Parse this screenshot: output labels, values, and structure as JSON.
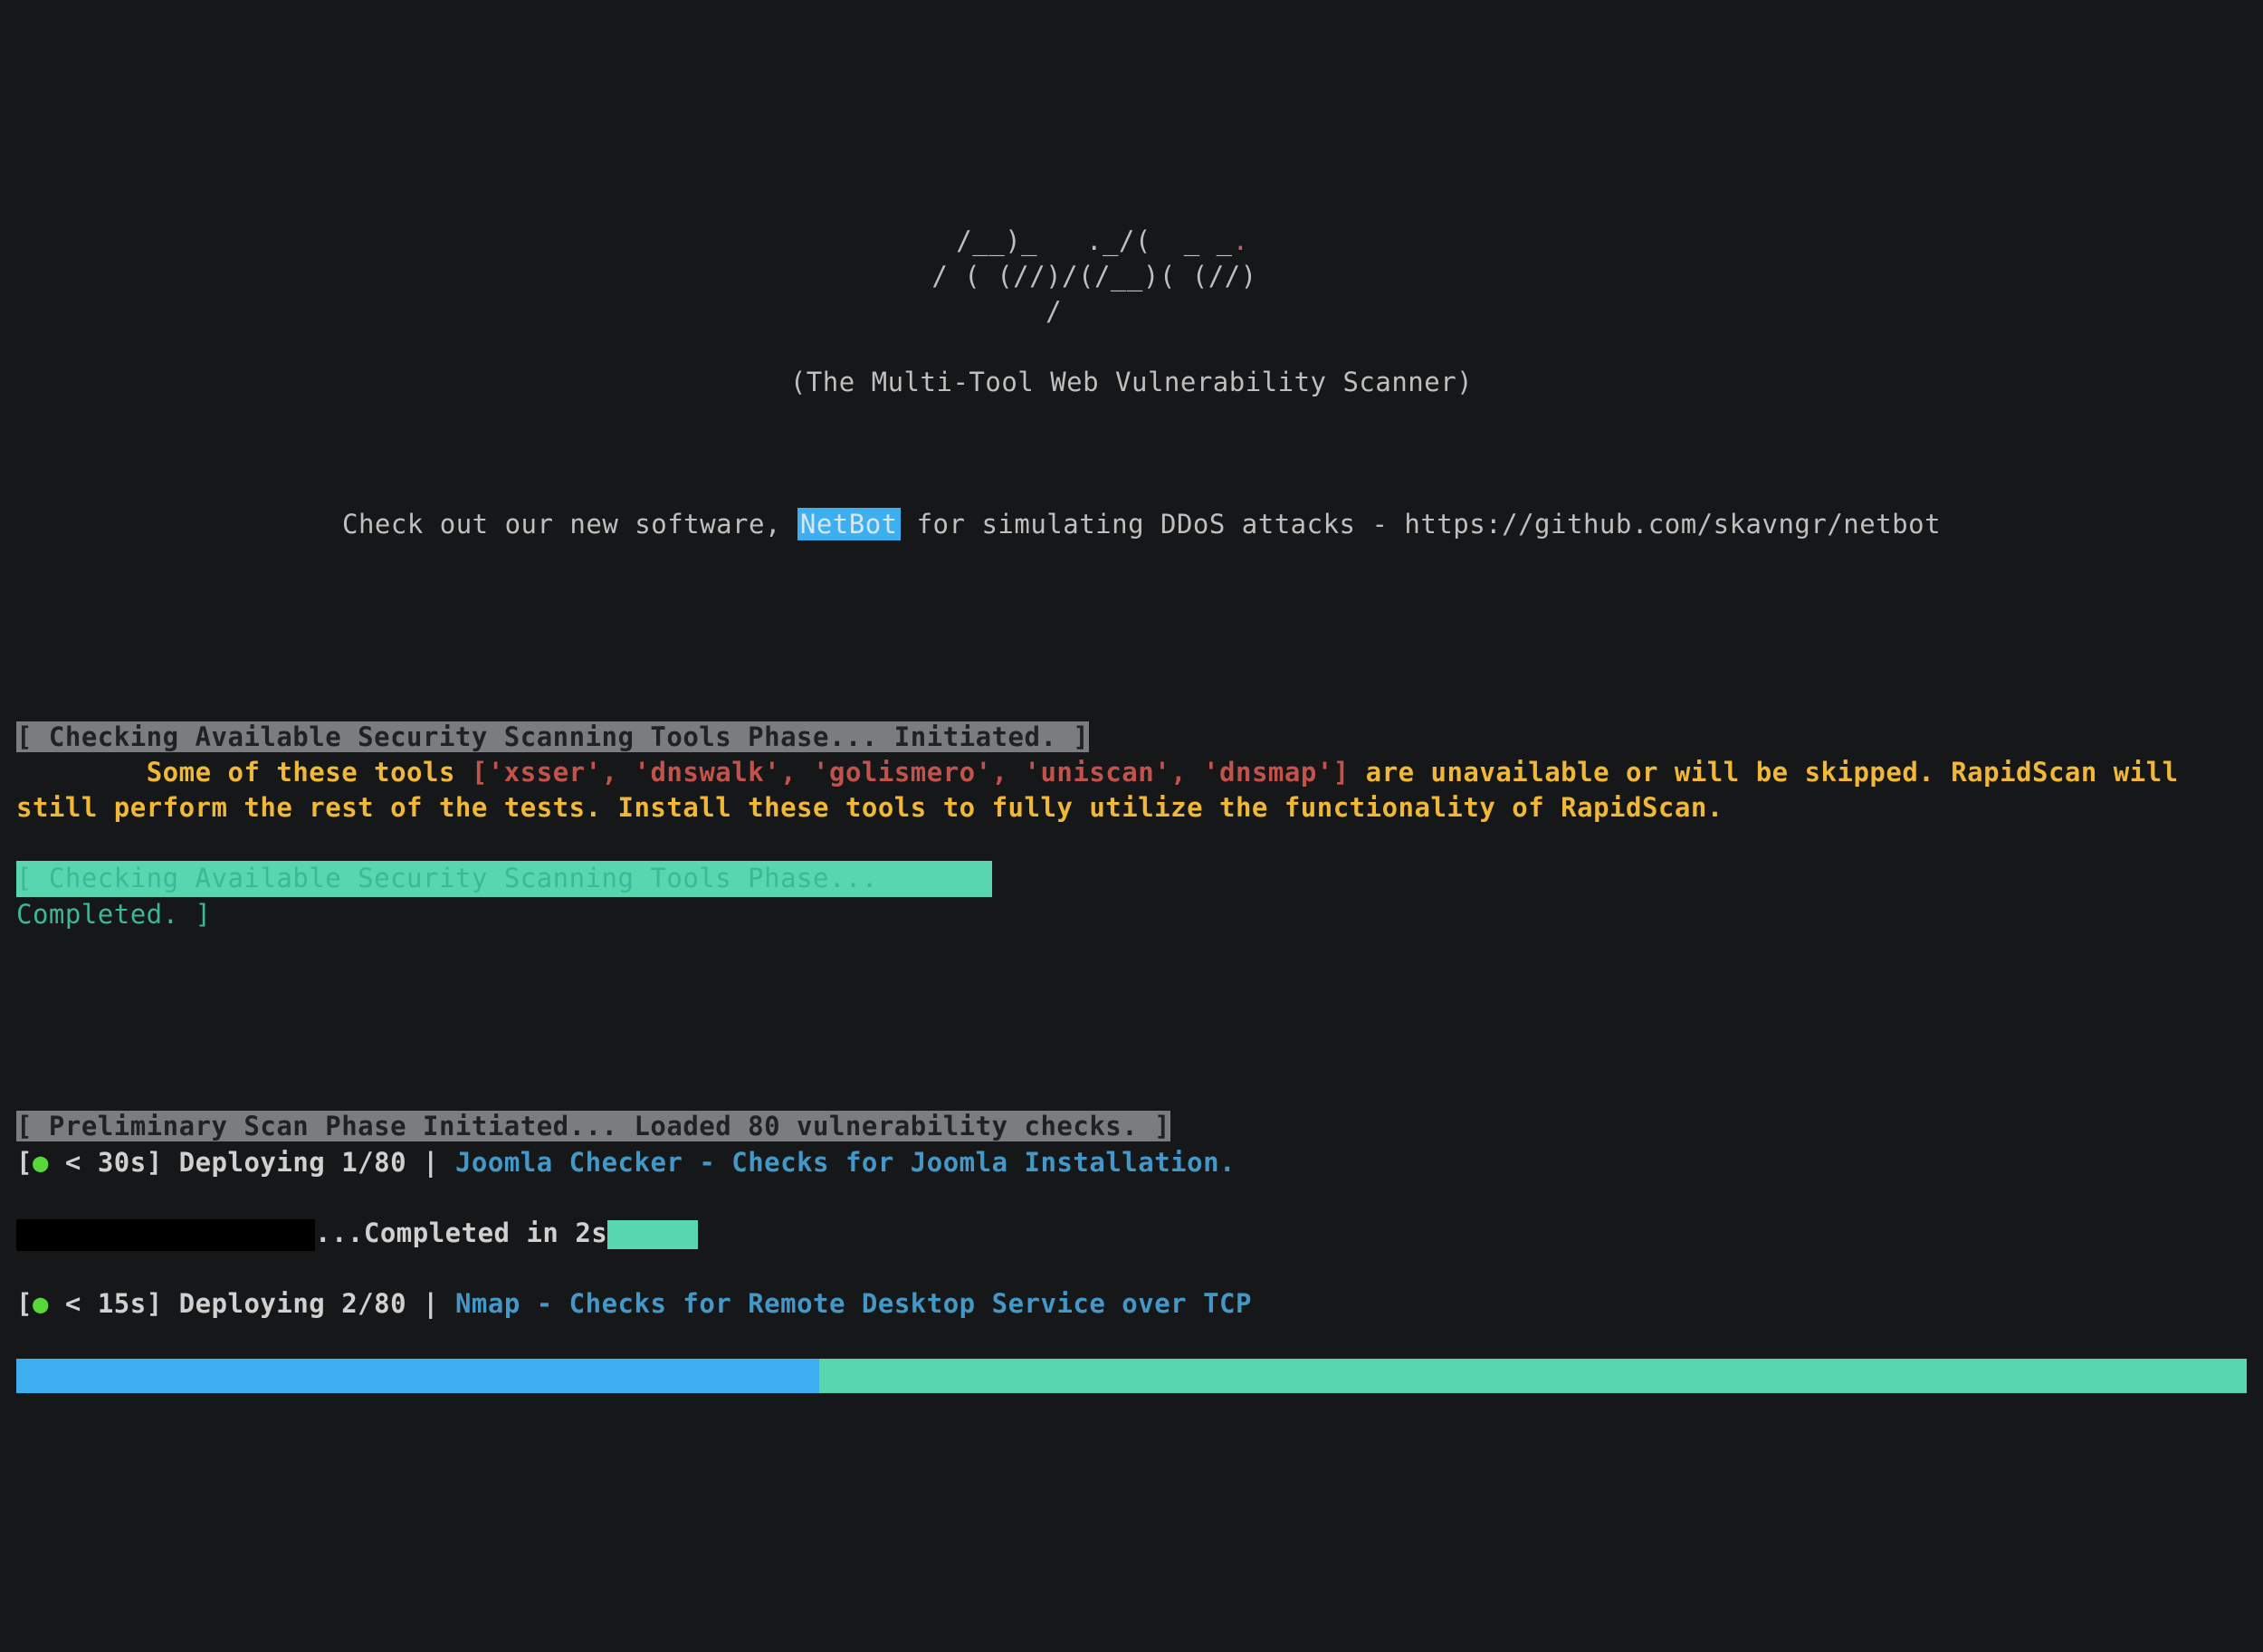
{
  "ascii": {
    "l1": "  /__)_   ._/(  _ _",
    "l2": " / ( (//)/(/__)( (//)",
    "l3": "        /            "
  },
  "tagline": "(The Multi-Tool Web Vulnerability Scanner)",
  "promo": {
    "before": "Check out our new software, ",
    "highlight": "NetBot",
    "after": " for simulating DDoS attacks - https://github.com/skavngr/netbot"
  },
  "phase1": "[ Checking Available Security Scanning Tools Phase... Initiated. ]",
  "tools_msg": {
    "prefix": "\tSome of these tools ",
    "list": "['xsser', 'dnswalk', 'golismero', 'uniscan', 'dnsmap']",
    "suffix": " are unavailable or will be skipped. RapidScan will still perform the rest of the tests. Install these tools to fully utilize the functionality of RapidScan."
  },
  "phase1_done": "[ Checking Available Security Scanning Tools Phase... Completed. ]",
  "phase2": "[ Preliminary Scan Phase Initiated... Loaded 80 vulnerability checks. ]",
  "scan1": {
    "time_open": "[",
    "dot": "●",
    "eta": " < 30s]",
    "deploy": " Deploying 1/80 | ",
    "name": "Joomla Checker",
    "desc": " - Checks for Joomla Installation."
  },
  "completed": "...Completed in 2s",
  "scan2": {
    "time_open": "[",
    "dot": "●",
    "eta": " < 15s]",
    "deploy": " Deploying 2/80 | ",
    "name": "Nmap",
    "desc": " - Checks for Remote Desktop Service over TCP"
  },
  "progress": {
    "blue_pct": 36,
    "teal_pct": 64
  }
}
